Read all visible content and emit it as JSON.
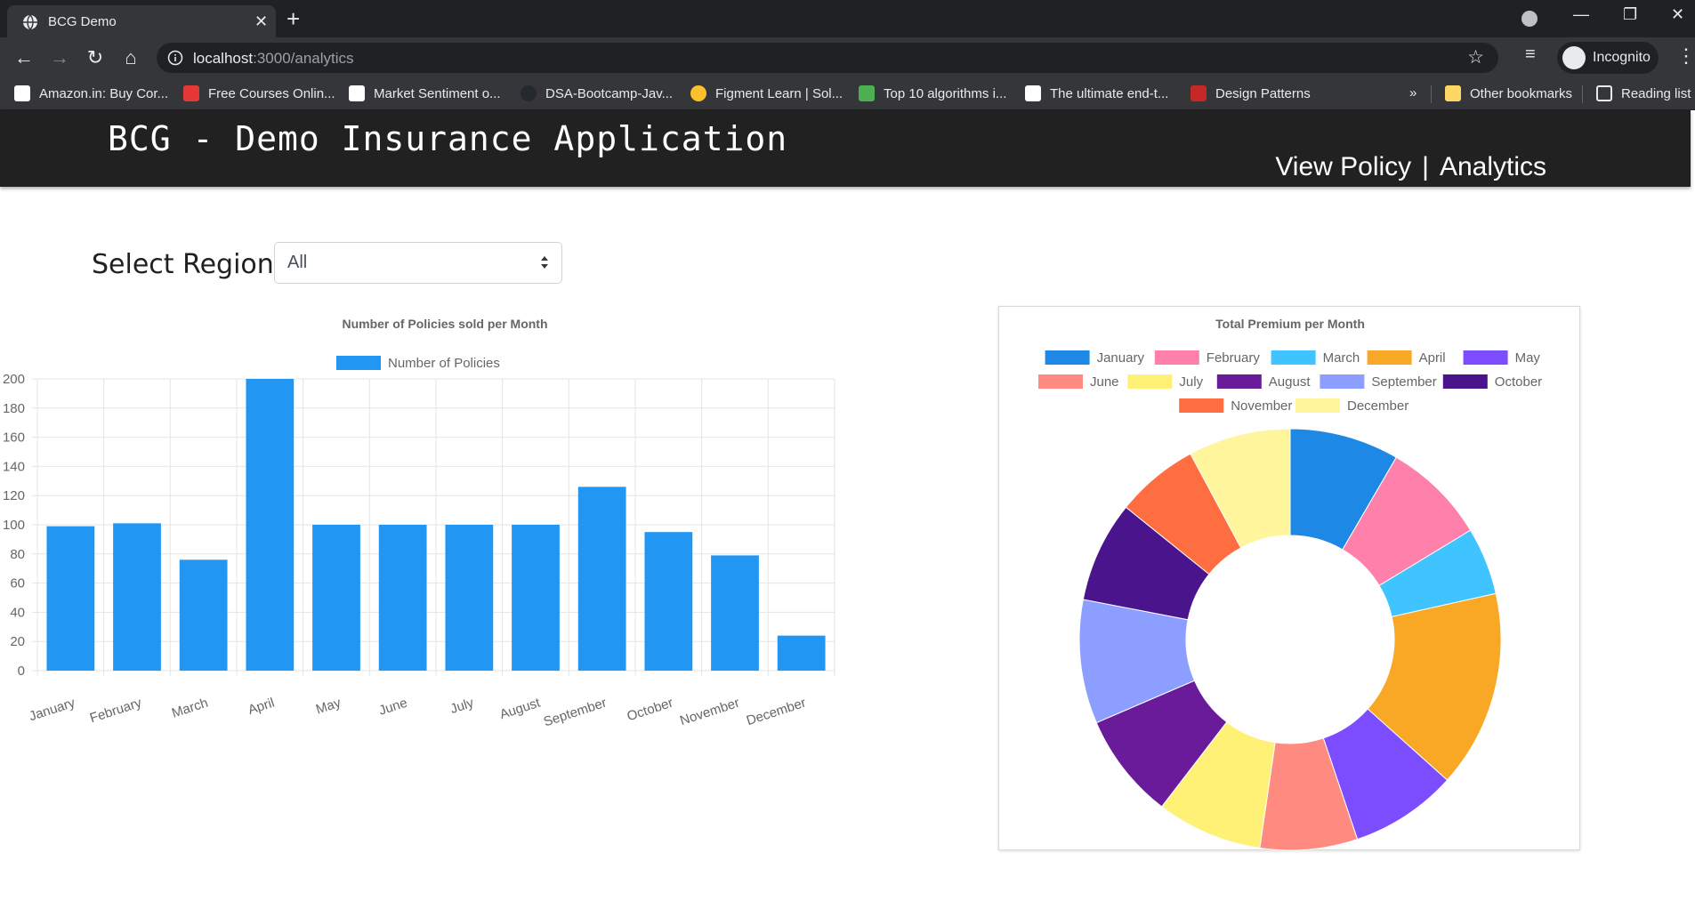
{
  "browser": {
    "tab_title": "BCG Demo",
    "url_host": "localhost",
    "url_path": ":3000/analytics",
    "incognito_label": "Incognito",
    "bookmarks": [
      {
        "label": "Amazon.in: Buy Cor...",
        "color": "#ffffff"
      },
      {
        "label": "Free Courses Onlin...",
        "color": "#e53935"
      },
      {
        "label": "Market Sentiment o...",
        "color": "#ffffff"
      },
      {
        "label": "DSA-Bootcamp-Jav...",
        "color": "#24292e"
      },
      {
        "label": "Figment Learn | Sol...",
        "color": "#fbc02d"
      },
      {
        "label": "Top 10 algorithms i...",
        "color": "#4caf50"
      },
      {
        "label": "The ultimate end-t...",
        "color": "#ffffff"
      },
      {
        "label": "Design Patterns",
        "color": "#c62828"
      }
    ],
    "other_bookmarks": "Other bookmarks",
    "reading_list": "Reading list"
  },
  "app": {
    "title": "BCG - Demo Insurance Application",
    "nav_view_policy": "View Policy",
    "nav_separator": "|",
    "nav_analytics": "Analytics"
  },
  "filter": {
    "label": "Select Region",
    "selected": "All"
  },
  "chart_data": [
    {
      "type": "bar",
      "title": "Number of Policies sold per Month",
      "categories": [
        "January",
        "February",
        "March",
        "April",
        "May",
        "June",
        "July",
        "August",
        "September",
        "October",
        "November",
        "December"
      ],
      "series": [
        {
          "name": "Number of Policies",
          "values": [
            99,
            101,
            76,
            200,
            100,
            100,
            100,
            100,
            126,
            95,
            79,
            24
          ],
          "color": "#2196f3"
        }
      ],
      "ylim": [
        0,
        200
      ],
      "yticks": [
        0,
        20,
        40,
        60,
        80,
        100,
        120,
        140,
        160,
        180,
        200
      ],
      "grid": true,
      "legend": "top"
    },
    {
      "type": "pie",
      "donut": true,
      "title": "Total Premium per Month",
      "labels": [
        "January",
        "February",
        "March",
        "April",
        "May",
        "June",
        "July",
        "August",
        "September",
        "October",
        "November",
        "December"
      ],
      "values": [
        9.1,
        8.6,
        5.6,
        16.4,
        8.9,
        8.1,
        8.8,
        8.8,
        10.3,
        8.4,
        6.9,
        8.5
      ],
      "colors": [
        "#1e88e5",
        "#ff80ab",
        "#40c4ff",
        "#f9a825",
        "#7c4dff",
        "#ff8a80",
        "#fff176",
        "#6a1b9a",
        "#8c9eff",
        "#4a148c",
        "#ff6e40",
        "#fff59d"
      ],
      "legend": "top"
    }
  ]
}
